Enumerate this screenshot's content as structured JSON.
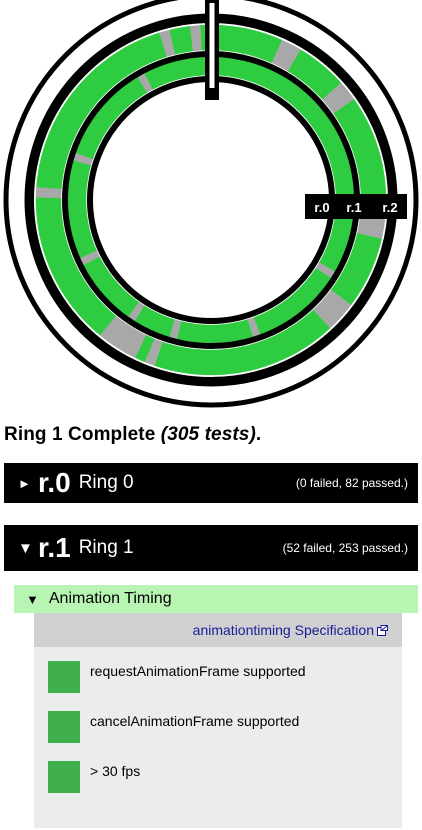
{
  "chart": {
    "ring_labels": [
      "r.0",
      "r.1",
      "r.2"
    ],
    "colors": {
      "pass": "#2ecc40",
      "fail": "#a8a8a8",
      "line": "#000000",
      "bg": "#ffffff"
    }
  },
  "status": {
    "prefix": "Ring 1 Complete ",
    "tests": "(305 tests)",
    "suffix": "."
  },
  "rings": [
    {
      "code": "r.0",
      "name": "Ring 0",
      "counts": "(0 failed, 82 passed.)",
      "expanded": false,
      "indicator": "►"
    },
    {
      "code": "r.1",
      "name": "Ring 1",
      "counts": "(52 failed, 253 passed.)",
      "expanded": true,
      "indicator": "▼"
    }
  ],
  "section": {
    "indicator": "▼",
    "title": "Animation Timing",
    "spec_link": "animationtiming Specification",
    "tests": [
      {
        "label": "requestAnimationFrame supported",
        "status": "pass"
      },
      {
        "label": "cancelAnimationFrame supported",
        "status": "pass"
      },
      {
        "label": "> 30 fps",
        "status": "pass"
      }
    ],
    "pass_color": "#3fb04b"
  }
}
